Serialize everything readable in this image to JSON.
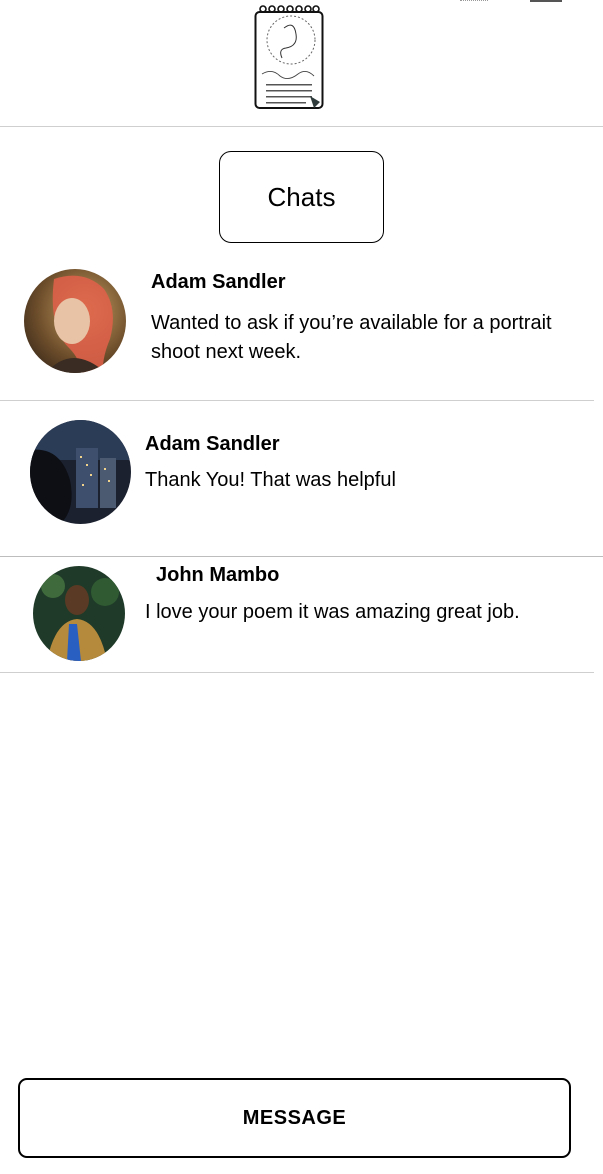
{
  "header": {
    "logo_icon": "notebook-logo-icon"
  },
  "page": {
    "title": "Chats"
  },
  "chats": [
    {
      "name": "Adam Sandler",
      "preview": "Wanted to ask if you’re available for a portrait shoot next week."
    },
    {
      "name": "Adam Sandler",
      "preview": "Thank You! That was helpful"
    },
    {
      "name": "John Mambo",
      "preview": "I love your poem it was amazing great job."
    }
  ],
  "footer": {
    "message_label": "MESSAGE"
  }
}
